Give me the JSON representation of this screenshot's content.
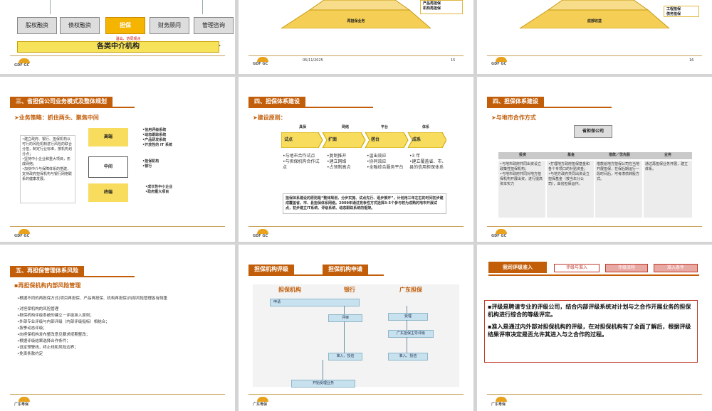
{
  "s1": {
    "buttons": [
      "股权融资",
      "债权融资",
      "担保",
      "财务顾问",
      "管理咨询"
    ],
    "red_note": "温出、协同观点",
    "bar": "各类中介机构"
  },
  "s2": {
    "pyramid_label": "再担保业务",
    "side_label": "产品再担保\n机构再担保",
    "date": "05/11/2025",
    "page": "15"
  },
  "s3": {
    "pyramid_label": "底部收益",
    "side_label": "工程担保\n债务担保",
    "page": "16"
  },
  "s4": {
    "title": "三、省担保公司业务模式及整体规划",
    "sub": "➤业务策略：抓住两头、聚焦中间",
    "left_text": "•建立政府、银行、担保机构以可行的风险机制进行风险的联合分担，制定行业标准，按机构划分点；\n•坚持中小企业和重大项目，形成网络；\n•加快中介与保障体系的搭建，支持政府担保机构与银行网络联系的健康发展。",
    "blocks": [
      "高端",
      "中间",
      "终端"
    ],
    "right_top": "•信用评级系统\n•动态跟踪系统\n•产品研发系统\n•开放性的 IT 系统",
    "right_mid": "•担保机构\n•银行",
    "right_bot": "•成长性中小企业\n•政府重大项目"
  },
  "s5": {
    "title": "四、担保体系建设",
    "sub": "➤建设原则：",
    "col_heads": [
      "具保",
      "网络",
      "平台",
      "体系"
    ],
    "arrows": [
      "试点",
      "扩面",
      "搭台",
      "成系"
    ],
    "cols": [
      "•与地市合作试点\n•与担保机构合作试点",
      "•复制推开\n•建立网络\n•占领制高点",
      "•温出效应\n•协同效应\n•全融综合服务平台",
      "•3 年\n•建立覆盖省、市、县的信用担保体系"
    ],
    "note": "担保体系建设的原则是“整体规划、分步实施、试点先行、逐步推开”，计划用三年左右的时间初步建成覆盖省、市、县担保体系网络。2009年通过竞争性方式选择3-5个参与较为成熟的地市开展试点，初步建立IT系统、评级系统、动态跟踪系统的框架。"
  },
  "s6": {
    "title": "四、担保体系建设",
    "sub": "➤与地市合作方式",
    "top_box": "省担保公司",
    "heads": [
      "投资",
      "基金",
      "借款／优先股",
      "业务"
    ],
    "cells": [
      "•与地市政府共同出资设立政策性担保机构；\n•与地市政府共同对地方担保机构开展出资，进行提高资本实力",
      "•打理地方政府担保基金和各个专项口的补贴资金；\n•与地方政府共同出资设立担保基金（按当年分公司），由省担保运作。",
      "借款给地方担保公司在当地开展担保，在保后期运行一段时间后，可考虑债转股方式。",
      "通过再担保业务开展，建立体系。"
    ]
  },
  "s7": {
    "title": "五、再担保管理体系风险",
    "sub": "▪再担保机构内部风险管理",
    "lines": [
      "•根据不同的再担保方式(项目再担保、产品再担保、机构再担保)内部风险管理各有侧重",
      "",
      "•对担保机构的风险管理",
      "•担保机构评级系统的建立－评级准入原则；",
      "•外部专业评级与内部评级（内部评级指标）相结合；",
      "•按季动态评级；",
      "•向担保机构发布整改意见要求按期整改；",
      "•根据评级结果选择合作条件；",
      "•设定预警线，终止线和风险边界；",
      "•免责条款约定"
    ]
  },
  "s8": {
    "tab1": "担保机构评级",
    "tab2": "担保机构申请",
    "cols": [
      "担保机构",
      "银行",
      "广东担保"
    ],
    "nodes": [
      "申请",
      "评审",
      "受理",
      "广东担保主导评级",
      "准入、授信",
      "准入、授信",
      "开始受理业务"
    ]
  },
  "s9": {
    "badge": "我司评级准入",
    "tabs": [
      "评级与准入",
      "评级流程",
      "准入条件"
    ],
    "para1": "▪评级是聘请专业的评级公司，结合内部评级系统对计划与之合作开展业务的担保机构进行综合的等级评定。",
    "para2": "▪准入是通过内外部对担保机构的评级，在对担保机构有了全面了解后，根据评级结果评审决定是否允许其进入与之合作的过程。"
  },
  "logo": {
    "brand": "GDF GC",
    "cn": "广东粤保"
  }
}
